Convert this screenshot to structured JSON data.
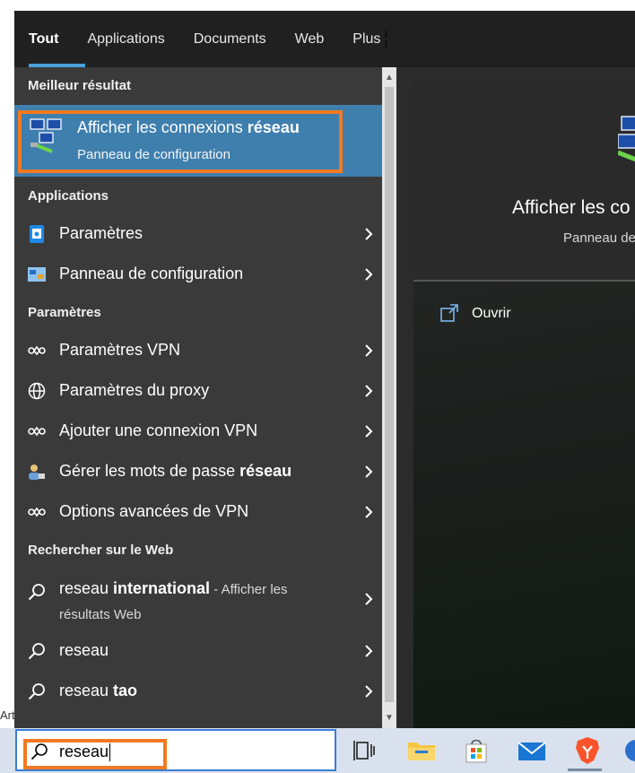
{
  "tabs": [
    {
      "label": "Tout"
    },
    {
      "label": "Applications"
    },
    {
      "label": "Documents"
    },
    {
      "label": "Web"
    },
    {
      "label": "Plus"
    }
  ],
  "sections": {
    "best": "Meilleur résultat",
    "apps": "Applications",
    "settings": "Paramètres",
    "web": "Rechercher sur le Web"
  },
  "best_match": {
    "title_normal": "Afficher les connexions ",
    "title_bold": "réseau",
    "subtitle": "Panneau de configuration"
  },
  "apps": [
    {
      "label": "Paramètres"
    },
    {
      "label": "Panneau de configuration"
    }
  ],
  "settings": [
    {
      "label_normal": "Paramètres VPN",
      "label_bold": ""
    },
    {
      "label_normal": "Paramètres du proxy",
      "label_bold": ""
    },
    {
      "label_normal": "Ajouter une connexion VPN",
      "label_bold": ""
    },
    {
      "label_normal": "Gérer les mots de passe ",
      "label_bold": "réseau"
    },
    {
      "label_normal": "Options avancées de VPN",
      "label_bold": ""
    }
  ],
  "web": [
    {
      "prefix": "reseau ",
      "bold": "international",
      "suffix": " - Afficher les",
      "line2": "résultats Web"
    },
    {
      "prefix": "reseau",
      "bold": "",
      "suffix": "",
      "line2": ""
    },
    {
      "prefix": "reseau ",
      "bold": "tao",
      "suffix": "",
      "line2": ""
    }
  ],
  "preview": {
    "title": "Afficher les co",
    "subtitle": "Panneau de",
    "open_label": "Ouvrir"
  },
  "search": {
    "query": "reseau"
  },
  "side_fragment": "Art",
  "colors": {
    "accent": "#4a9fd8",
    "selected": "#3f7fae",
    "highlight": "#f47920"
  }
}
